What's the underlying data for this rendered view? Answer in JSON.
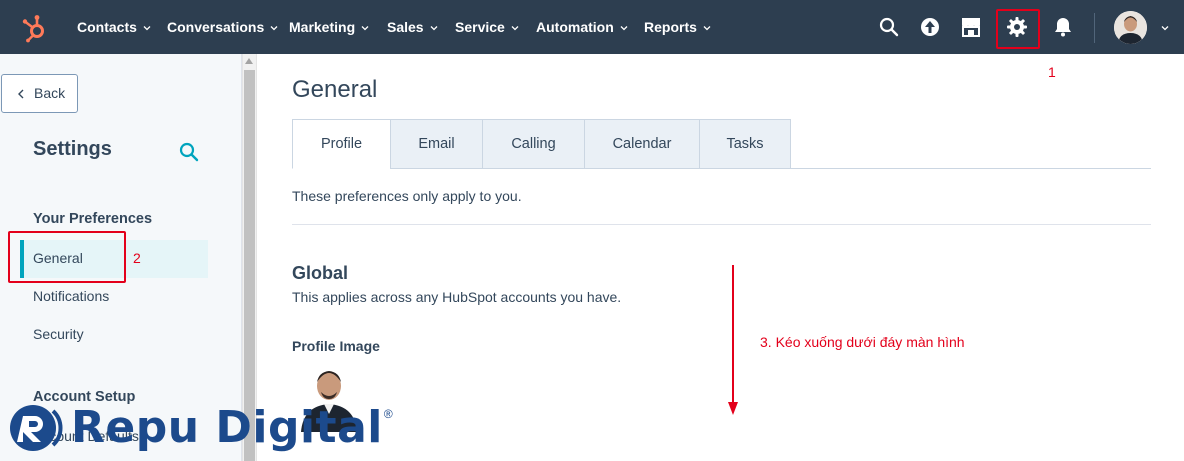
{
  "topnav": {
    "menu": [
      {
        "label": "Contacts",
        "name": "nav-contacts"
      },
      {
        "label": "Conversations",
        "name": "nav-conversations"
      },
      {
        "label": "Marketing",
        "name": "nav-marketing"
      },
      {
        "label": "Sales",
        "name": "nav-sales"
      },
      {
        "label": "Service",
        "name": "nav-service"
      },
      {
        "label": "Automation",
        "name": "nav-automation"
      },
      {
        "label": "Reports",
        "name": "nav-reports"
      }
    ],
    "icons": [
      "search-icon",
      "upgrade-icon",
      "marketplace-icon",
      "settings-gear-icon",
      "notifications-bell-icon"
    ]
  },
  "annotations": {
    "step1": "1",
    "step2": "2",
    "step3": "3. Kéo xuống dưới đáy màn hình"
  },
  "sidebar": {
    "back_label": "Back",
    "title": "Settings",
    "sections": [
      {
        "heading": "Your Preferences",
        "items": [
          "General",
          "Notifications",
          "Security"
        ]
      },
      {
        "heading": "Account Setup",
        "items": [
          "Account Defaults"
        ]
      }
    ]
  },
  "main": {
    "title": "General",
    "tabs": [
      "Profile",
      "Email",
      "Calling",
      "Calendar",
      "Tasks"
    ],
    "active_tab": "Profile",
    "note": "These preferences only apply to you.",
    "global_title": "Global",
    "global_sub": "This applies across any HubSpot accounts you have.",
    "profile_image_label": "Profile Image"
  },
  "watermark": {
    "text": "Repu Digital",
    "reg": "®"
  },
  "colors": {
    "nav_bg": "#2d3e50",
    "accent": "#00a4bd",
    "annotation_red": "#e3001b",
    "watermark_blue": "#1c4a8c"
  }
}
